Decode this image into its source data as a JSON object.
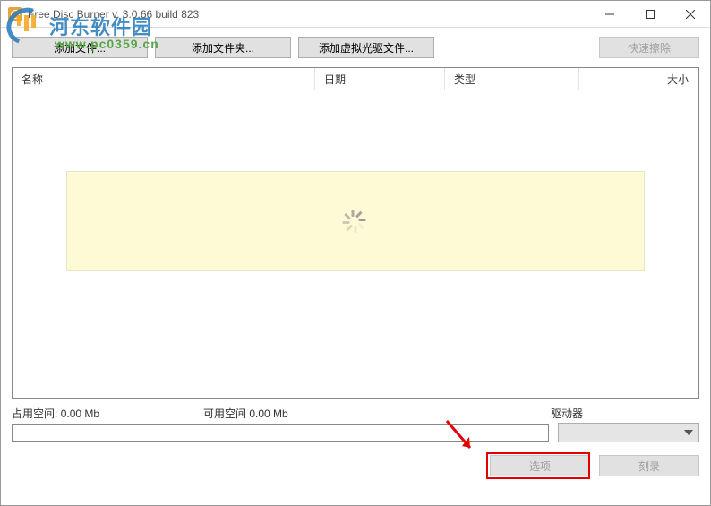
{
  "window": {
    "title": "Free Disc Burner   v. 3.0.66 build 823"
  },
  "watermark": {
    "text": "河东软件园",
    "url": "www.pc0359.cn"
  },
  "toolbar": {
    "add_files": "添加文件...",
    "add_folder": "添加文件夹...",
    "add_virtual": "添加虚拟光驱文件...",
    "quick_erase": "快速擦除"
  },
  "columns": {
    "name": "名称",
    "date": "日期",
    "type": "类型",
    "size": "大小"
  },
  "space": {
    "used_label": "占用空间:",
    "used_value": "0.00 Mb",
    "free_label": "可用空间",
    "free_value": "0.00 Mb",
    "drive_label": "驱动器"
  },
  "actions": {
    "options": "选项",
    "burn": "刻录"
  }
}
